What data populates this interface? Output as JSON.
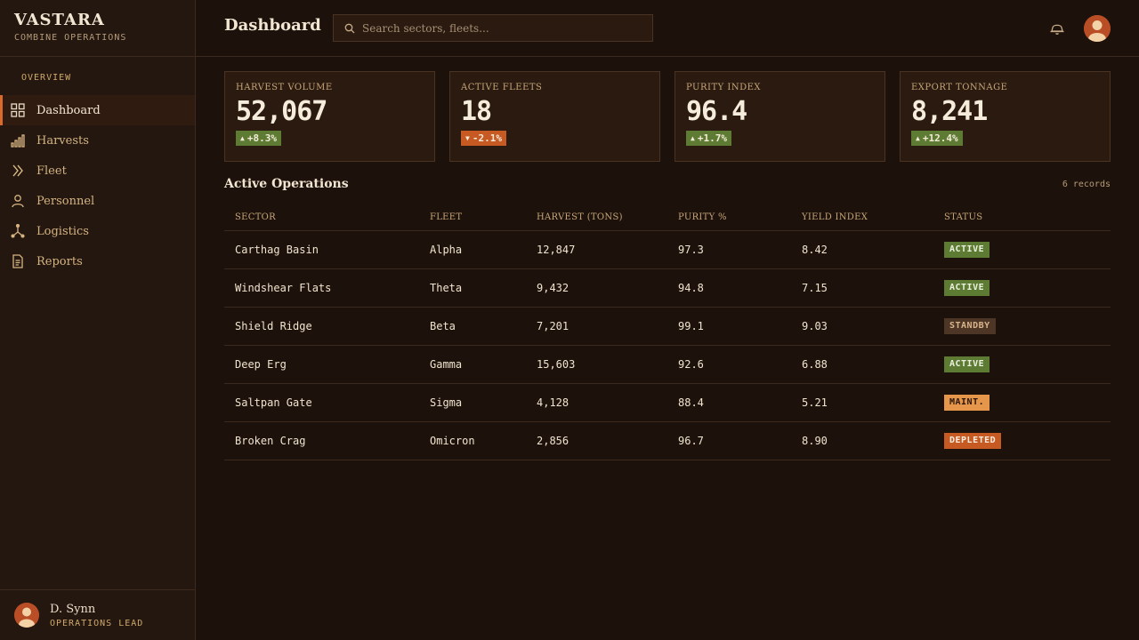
{
  "brand": {
    "title": "VASTARA",
    "subtitle": "COMBINE OPERATIONS"
  },
  "sidebar": {
    "section": "OVERVIEW",
    "items": [
      {
        "label": "Dashboard",
        "icon": "grid-icon",
        "active": true
      },
      {
        "label": "Harvests",
        "icon": "bar-chart-icon"
      },
      {
        "label": "Fleet",
        "icon": "chevrons-right-icon"
      },
      {
        "label": "Personnel",
        "icon": "person-icon"
      },
      {
        "label": "Logistics",
        "icon": "network-icon"
      },
      {
        "label": "Reports",
        "icon": "document-icon"
      }
    ],
    "user": {
      "name": "D. Synn",
      "role": "OPERATIONS LEAD"
    }
  },
  "header": {
    "title": "Dashboard",
    "search_placeholder": "Search sectors, fleets..."
  },
  "stats": [
    {
      "label": "HARVEST VOLUME",
      "value": "52,067",
      "delta": "+8.3%",
      "direction": "up"
    },
    {
      "label": "ACTIVE FLEETS",
      "value": "18",
      "delta": "-2.1%",
      "direction": "down"
    },
    {
      "label": "PURITY INDEX",
      "value": "96.4",
      "delta": "+1.7%",
      "direction": "up"
    },
    {
      "label": "EXPORT TONNAGE",
      "value": "8,241",
      "delta": "+12.4%",
      "direction": "up"
    }
  ],
  "operations": {
    "title": "Active Operations",
    "records": "6 records",
    "columns": [
      "SECTOR",
      "FLEET",
      "HARVEST (TONS)",
      "PURITY %",
      "YIELD INDEX",
      "STATUS"
    ],
    "rows": [
      {
        "sector": "Carthag Basin",
        "fleet": "Alpha",
        "harvest": "12,847",
        "purity": "97.3",
        "yield": "8.42",
        "status": "ACTIVE"
      },
      {
        "sector": "Windshear Flats",
        "fleet": "Theta",
        "harvest": "9,432",
        "purity": "94.8",
        "yield": "7.15",
        "status": "ACTIVE"
      },
      {
        "sector": "Shield Ridge",
        "fleet": "Beta",
        "harvest": "7,201",
        "purity": "99.1",
        "yield": "9.03",
        "status": "STANDBY"
      },
      {
        "sector": "Deep Erg",
        "fleet": "Gamma",
        "harvest": "15,603",
        "purity": "92.6",
        "yield": "6.88",
        "status": "ACTIVE"
      },
      {
        "sector": "Saltpan Gate",
        "fleet": "Sigma",
        "harvest": "4,128",
        "purity": "88.4",
        "yield": "5.21",
        "status": "MAINT."
      },
      {
        "sector": "Broken Crag",
        "fleet": "Omicron",
        "harvest": "2,856",
        "purity": "96.7",
        "yield": "8.90",
        "status": "DEPLETED"
      }
    ]
  },
  "colors": {
    "accent": "#d96a2a",
    "up": "#5d7b32",
    "down": "#c75a23",
    "standby": "#4e3626",
    "maint": "#e5964a",
    "background": "#1d120b"
  }
}
